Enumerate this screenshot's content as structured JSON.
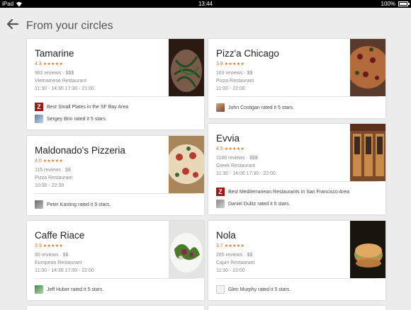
{
  "status_bar": {
    "carrier": "iPad",
    "time": "13:44",
    "battery": "100%"
  },
  "header": {
    "title": "From your circles"
  },
  "colors": {
    "accent": "#e0731b",
    "zagat": "#9b1a1a"
  },
  "cards": [
    {
      "name": "Tamarine",
      "rating": "4.3",
      "stars": "★★★★★",
      "reviews": "962 reviews · $$$",
      "category": "Vietnamese Restaurant",
      "hours": "11:30 - 14:30  17:30 - 21:00",
      "footer": [
        {
          "icon": "zagat-icon",
          "text": "Best Small Plates in the SF Bay Area"
        },
        {
          "icon": "avatar-icon",
          "text": "Sergey Brin rated it 5 stars."
        }
      ]
    },
    {
      "name": "Pizz'a Chicago",
      "rating": "3.9",
      "stars": "★★★★★",
      "reviews": "163 reviews · $$",
      "category": "Pizza Restaurant",
      "hours": "11:00 - 22:00",
      "footer": [
        {
          "icon": "avatar-icon",
          "text": "John Costigan rated it 5 stars."
        }
      ]
    },
    {
      "name": "Evvia",
      "rating": "4.5",
      "stars": "★★★★★",
      "reviews": "1188 reviews · $$$",
      "category": "Greek Restaurant",
      "hours": "11:30 - 14:00  17:30 - 22:00",
      "footer": [
        {
          "icon": "zagat-icon",
          "text": "Best Mediterranean Restaurants in San Francisco Area"
        },
        {
          "icon": "avatar-icon",
          "text": "Daniel Dulitz rated it 5 stars."
        }
      ]
    },
    {
      "name": "Maldonado's Pizzeria",
      "rating": "4.0",
      "stars": "★★★★★",
      "reviews": "115 reviews · $$",
      "category": "Pizza Restaurant",
      "hours": "10:30 - 22:30",
      "footer": [
        {
          "icon": "avatar-icon",
          "text": "Peter Kasting rated it 5 stars."
        }
      ]
    },
    {
      "name": "Caffe Riace",
      "rating": "3.9",
      "stars": "★★★★★",
      "reviews": "80 reviews · $$",
      "category": "European Restaurant",
      "hours": "11:30 - 14:30  17:00 - 22:00",
      "footer": [
        {
          "icon": "avatar-icon",
          "text": "Jeff Huber rated it 5 stars."
        }
      ]
    },
    {
      "name": "Nola",
      "rating": "3.7",
      "stars": "★★★★★",
      "reviews": "285 reviews · $$",
      "category": "Cajun Restaurant",
      "hours": "11:30 - 22:00",
      "footer": [
        {
          "icon": "avatar-icon",
          "text": "Glen Murphy rated it 5 stars."
        }
      ]
    }
  ],
  "zagat_letter": "Z"
}
